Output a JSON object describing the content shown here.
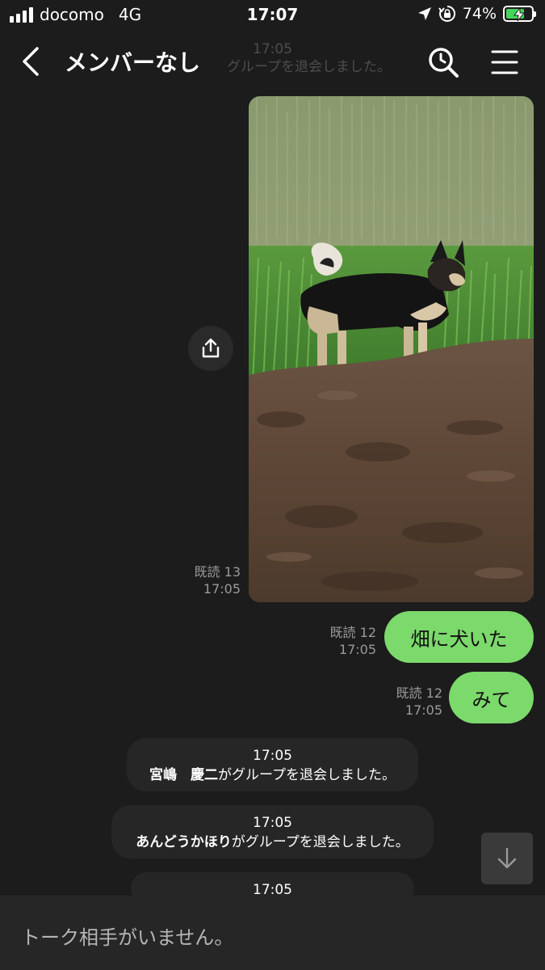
{
  "status_bar": {
    "carrier": "docomo",
    "network": "4G",
    "time": "17:07",
    "battery_percent": "74%",
    "battery_level": 0.74,
    "icons": [
      "signal-icon",
      "location-arrow-icon",
      "orientation-lock-icon",
      "battery-charging-icon"
    ]
  },
  "header": {
    "title": "メンバーなし",
    "ghost_time": "17:05",
    "ghost_text": "グループを退会しました。",
    "icons": [
      "back-chevron-icon",
      "search-icon",
      "menu-icon"
    ]
  },
  "messages": [
    {
      "type": "image",
      "alt": "photo-dog-in-field",
      "read": "既読 13",
      "time": "17:05"
    },
    {
      "type": "text",
      "text": "畑に犬いた",
      "read": "既読 12",
      "time": "17:05"
    },
    {
      "type": "text",
      "text": "みて",
      "read": "既読 12",
      "time": "17:05"
    }
  ],
  "system_messages": [
    {
      "time": "17:05",
      "name": "宮嶋　慶二",
      "text": "がグループを退会しました。"
    },
    {
      "time": "17:05",
      "name": "あんどうかほり",
      "text": "がグループを退会しました。"
    },
    {
      "time": "17:05",
      "name": "",
      "text": ""
    }
  ],
  "footer": {
    "placeholder": "トーク相手がいません。"
  },
  "colors": {
    "background": "#1c1c1c",
    "bubble_green": "#7cd96b",
    "system_bubble": "#262626",
    "battery_green": "#44d55a"
  }
}
